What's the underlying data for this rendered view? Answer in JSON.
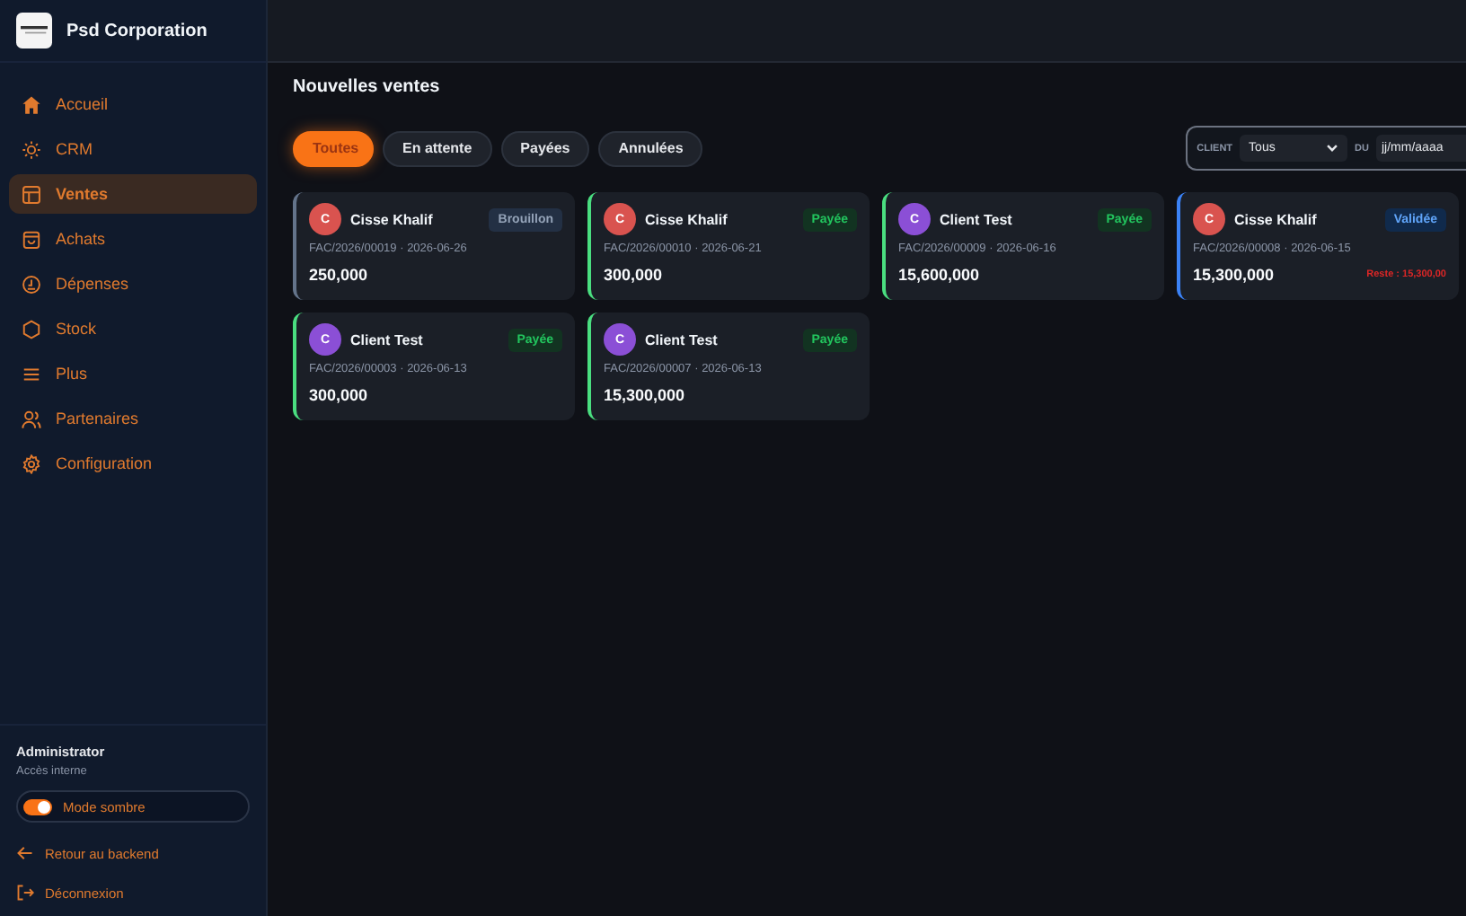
{
  "brand": {
    "name": "Psd Corporation"
  },
  "nav": [
    {
      "label": "Accueil",
      "selected": false
    },
    {
      "label": "CRM",
      "selected": false
    },
    {
      "label": "Ventes",
      "selected": true
    },
    {
      "label": "Achats",
      "selected": false
    },
    {
      "label": "Dépenses",
      "selected": false
    },
    {
      "label": "Stock",
      "selected": false
    },
    {
      "label": "Plus",
      "selected": false
    },
    {
      "label": "Partenaires",
      "selected": false
    },
    {
      "label": "Configuration",
      "selected": false
    }
  ],
  "user": {
    "name": "Administrator",
    "role": "Accès interne"
  },
  "dark_mode": {
    "label": "Mode sombre",
    "on": true
  },
  "footer_links": [
    {
      "label": "Retour au backend"
    },
    {
      "label": "Déconnexion"
    }
  ],
  "page_title": "Nouvelles ventes",
  "tabs": [
    {
      "label": "Toutes",
      "selected": true
    },
    {
      "label": "En attente",
      "selected": false
    },
    {
      "label": "Payées",
      "selected": false
    },
    {
      "label": "Annulées",
      "selected": false
    }
  ],
  "filters": {
    "client_label": "CLIENT",
    "client_value": "Tous",
    "date_label": "DU",
    "date_placeholder": "jj/mm/aaaa"
  },
  "invoices": [
    {
      "initial": "C",
      "client": "Cisse Khalif",
      "color": "#d9534f",
      "kind": "draft",
      "badge": "Brouillon",
      "ref": "FAC/2026/00019 · 2026-06-26",
      "amount": "250,000"
    },
    {
      "initial": "C",
      "client": "Cisse Khalif",
      "color": "#d9534f",
      "kind": "paid",
      "badge": "Payée",
      "ref": "FAC/2026/00010 · 2026-06-21",
      "amount": "300,000"
    },
    {
      "initial": "C",
      "client": "Client Test",
      "color": "#8b4fd6",
      "kind": "paid",
      "badge": "Payée",
      "ref": "FAC/2026/00009 · 2026-06-16",
      "amount": "15,600,000"
    },
    {
      "initial": "C",
      "client": "Cisse Khalif",
      "color": "#d9534f",
      "kind": "validated",
      "badge": "Validée",
      "ref": "FAC/2026/00008 · 2026-06-15",
      "amount": "15,300,000",
      "remaining": "Reste : 15,300,00"
    },
    {
      "initial": "C",
      "client": "Client Test",
      "color": "#8b4fd6",
      "kind": "paid",
      "badge": "Payée",
      "ref": "FAC/2026/00003 · 2026-06-13",
      "amount": "300,000"
    },
    {
      "initial": "C",
      "client": "Client Test",
      "color": "#8b4fd6",
      "kind": "paid",
      "badge": "Payée",
      "ref": "FAC/2026/00007 · 2026-06-13",
      "amount": "15,300,000"
    }
  ]
}
